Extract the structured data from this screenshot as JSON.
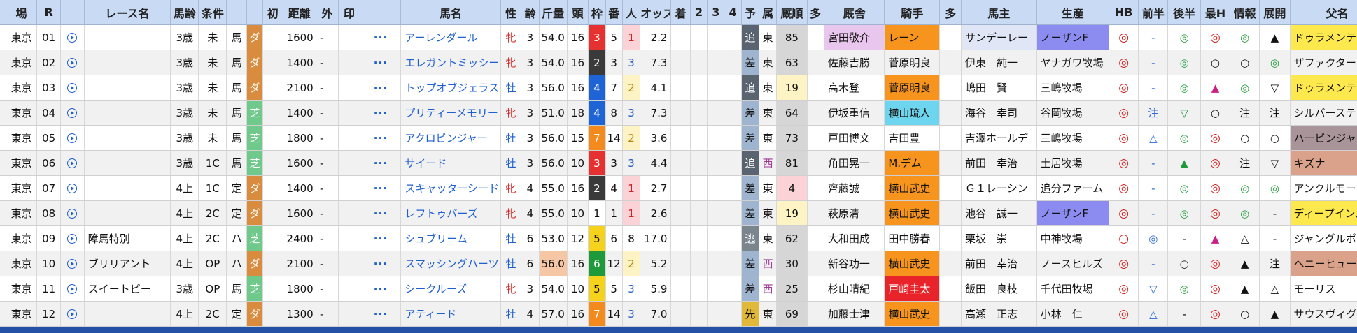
{
  "headers": [
    "場",
    "R",
    "",
    "レース名",
    "馬齢",
    "条件",
    "",
    "初",
    "距離",
    "外",
    "印",
    "",
    "馬名",
    "性",
    "齢",
    "斤量",
    "頭",
    "枠",
    "番",
    "人",
    "オッズ",
    "着",
    "2",
    "3",
    "4",
    "予",
    "属",
    "厩順",
    "多",
    "厩舎",
    "騎手",
    "多",
    "馬主",
    "生産",
    "HB",
    "前半",
    "後半",
    "最H",
    "情報",
    "展開",
    "父名",
    ""
  ],
  "rows": [
    {
      "place": "東京",
      "r": "01",
      "race": "",
      "age": "3歳",
      "cond": "未",
      "kind": "馬",
      "surface": "ダ",
      "dist": "1600",
      "out": "-",
      "horse": "アーレンダール",
      "sex": "牝",
      "old": "3",
      "kinryo": "54.0",
      "heads": "16",
      "waku": "3",
      "ban": "5",
      "pop": "1",
      "odds": "2.2",
      "yoso": "追",
      "zoku": "東",
      "rate": "85",
      "kyusha": "宮田敬介",
      "jockey": "レーン",
      "owner": "サンデーレー",
      "breeder": "ノーザンF",
      "hb": "◎",
      "zen": "-",
      "kou": "◎",
      "saih": "◎",
      "joho": "◎",
      "tenkai": "▲",
      "sire": "ドゥラメンテ"
    },
    {
      "place": "東京",
      "r": "02",
      "race": "",
      "age": "3歳",
      "cond": "未",
      "kind": "馬",
      "surface": "ダ",
      "dist": "1400",
      "out": "-",
      "horse": "エレガントミッシー",
      "sex": "牝",
      "old": "3",
      "kinryo": "54.0",
      "heads": "16",
      "waku": "2",
      "ban": "3",
      "pop": "3",
      "odds": "7.3",
      "yoso": "差",
      "zoku": "東",
      "rate": "63",
      "kyusha": "佐藤吉勝",
      "jockey": "菅原明良",
      "owner": "伊東　純一",
      "breeder": "ヤナガワ牧場",
      "hb": "◎",
      "zen": "-",
      "kou": "◎",
      "saih": "○",
      "joho": "○",
      "tenkai": "◎",
      "sire": "ザファクター"
    },
    {
      "place": "東京",
      "r": "03",
      "race": "",
      "age": "3歳",
      "cond": "未",
      "kind": "馬",
      "surface": "ダ",
      "dist": "2100",
      "out": "-",
      "horse": "トップオブジェラス",
      "sex": "牡",
      "old": "3",
      "kinryo": "56.0",
      "heads": "16",
      "waku": "4",
      "ban": "7",
      "pop": "2",
      "odds": "4.1",
      "yoso": "追",
      "zoku": "東",
      "rate": "19",
      "kyusha": "高木登",
      "jockey": "菅原明良",
      "owner": "嶋田　賢",
      "breeder": "三嶋牧場",
      "hb": "◎",
      "zen": "-",
      "kou": "◎",
      "saih": "▲",
      "joho": "◎",
      "tenkai": "▽",
      "sire": "ドゥラメンテ"
    },
    {
      "place": "東京",
      "r": "04",
      "race": "",
      "age": "3歳",
      "cond": "未",
      "kind": "馬",
      "surface": "芝",
      "dist": "1400",
      "out": "-",
      "horse": "プリティーメモリー",
      "sex": "牝",
      "old": "3",
      "kinryo": "51.0",
      "heads": "18",
      "waku": "4",
      "ban": "8",
      "pop": "3",
      "odds": "7.3",
      "yoso": "差",
      "zoku": "東",
      "rate": "64",
      "kyusha": "伊坂重信",
      "jockey": "横山琉人",
      "owner": "海谷　幸司",
      "breeder": "谷岡牧場",
      "hb": "◎",
      "zen": "注",
      "kou": "▽",
      "saih": "○",
      "joho": "注",
      "tenkai": "注",
      "sire": "シルバーステート"
    },
    {
      "place": "東京",
      "r": "05",
      "race": "",
      "age": "3歳",
      "cond": "未",
      "kind": "馬",
      "surface": "芝",
      "dist": "1800",
      "out": "-",
      "horse": "アクロビンジャー",
      "sex": "牡",
      "old": "3",
      "kinryo": "56.0",
      "heads": "15",
      "waku": "7",
      "ban": "14",
      "pop": "2",
      "odds": "3.6",
      "yoso": "差",
      "zoku": "東",
      "rate": "73",
      "kyusha": "戸田博文",
      "jockey": "吉田豊",
      "owner": "吉澤ホールデ",
      "breeder": "三嶋牧場",
      "hb": "◎",
      "zen": "△",
      "kou": "◎",
      "saih": "◎",
      "joho": "○",
      "tenkai": "○",
      "sire": "ハービンジャー"
    },
    {
      "place": "東京",
      "r": "06",
      "race": "",
      "age": "3歳",
      "cond": "1C",
      "kind": "馬",
      "surface": "芝",
      "dist": "1600",
      "out": "-",
      "horse": "サイード",
      "sex": "牡",
      "old": "3",
      "kinryo": "56.0",
      "heads": "10",
      "waku": "3",
      "ban": "3",
      "pop": "3",
      "odds": "4.4",
      "yoso": "追",
      "zoku": "西",
      "rate": "81",
      "kyusha": "角田晃一",
      "jockey": "M.デム",
      "owner": "前田　幸治",
      "breeder": "土居牧場",
      "hb": "◎",
      "zen": "-",
      "kou": "▲",
      "saih": "◎",
      "joho": "注",
      "tenkai": "▽",
      "sire": "キズナ"
    },
    {
      "place": "東京",
      "r": "07",
      "race": "",
      "age": "4上",
      "cond": "1C",
      "kind": "定",
      "surface": "ダ",
      "dist": "1400",
      "out": "-",
      "horse": "スキャッターシード",
      "sex": "牝",
      "old": "4",
      "kinryo": "55.0",
      "heads": "16",
      "waku": "2",
      "ban": "4",
      "pop": "1",
      "odds": "2.7",
      "yoso": "差",
      "zoku": "東",
      "rate": "4",
      "kyusha": "齊藤誠",
      "jockey": "横山武史",
      "owner": "Ｇ１レーシン",
      "breeder": "追分ファーム",
      "hb": "◎",
      "zen": "-",
      "kou": "◎",
      "saih": "◎",
      "joho": "◎",
      "tenkai": "◎",
      "sire": "アンクルモー"
    },
    {
      "place": "東京",
      "r": "08",
      "race": "",
      "age": "4上",
      "cond": "2C",
      "kind": "定",
      "surface": "ダ",
      "dist": "1600",
      "out": "-",
      "horse": "レフトゥバーズ",
      "sex": "牝",
      "old": "4",
      "kinryo": "55.0",
      "heads": "10",
      "waku": "1",
      "ban": "1",
      "pop": "1",
      "odds": "2.6",
      "yoso": "差",
      "zoku": "東",
      "rate": "19",
      "kyusha": "萩原清",
      "jockey": "横山武史",
      "owner": "池谷　誠一",
      "breeder": "ノーザンF",
      "hb": "◎",
      "zen": "-",
      "kou": "◎",
      "saih": "◎",
      "joho": "◎",
      "tenkai": "-",
      "sire": "ディープインパクト"
    },
    {
      "place": "東京",
      "r": "09",
      "race": "障馬特別",
      "age": "4上",
      "cond": "2C",
      "kind": "ハ",
      "surface": "芝",
      "dist": "2400",
      "out": "-",
      "horse": "シュブリーム",
      "sex": "牡",
      "old": "6",
      "kinryo": "53.0",
      "heads": "12",
      "waku": "5",
      "ban": "6",
      "pop": "8",
      "odds": "17.0",
      "yoso": "逃",
      "zoku": "東",
      "rate": "62",
      "kyusha": "大和田成",
      "jockey": "田中勝春",
      "owner": "栗坂　崇",
      "breeder": "中神牧場",
      "hb": "○",
      "zen": "◎",
      "kou": "-",
      "saih": "▲",
      "joho": "△",
      "tenkai": "-",
      "sire": "ジャングルポケット"
    },
    {
      "place": "東京",
      "r": "10",
      "race": "ブリリアント",
      "age": "4上",
      "cond": "OP",
      "kind": "ハ",
      "surface": "ダ",
      "dist": "2100",
      "out": "-",
      "horse": "スマッシングハーツ",
      "sex": "牡",
      "old": "6",
      "kinryo": "56.0",
      "heads": "16",
      "waku": "6",
      "ban": "12",
      "pop": "2",
      "odds": "5.2",
      "yoso": "差",
      "zoku": "西",
      "rate": "30",
      "kyusha": "新谷功一",
      "jockey": "横山武史",
      "owner": "前田　幸治",
      "breeder": "ノースヒルズ",
      "hb": "◎",
      "zen": "-",
      "kou": "○",
      "saih": "◎",
      "joho": "▲",
      "tenkai": "注",
      "sire": "ヘニーヒューズ"
    },
    {
      "place": "東京",
      "r": "11",
      "race": "スイートピー",
      "age": "3歳",
      "cond": "OP",
      "kind": "馬",
      "surface": "芝",
      "dist": "1800",
      "out": "-",
      "horse": "シークルーズ",
      "sex": "牝",
      "old": "3",
      "kinryo": "54.0",
      "heads": "10",
      "waku": "5",
      "ban": "5",
      "pop": "3",
      "odds": "5.9",
      "yoso": "差",
      "zoku": "西",
      "rate": "25",
      "kyusha": "杉山晴紀",
      "jockey": "戸崎圭太",
      "owner": "飯田　良枝",
      "breeder": "千代田牧場",
      "hb": "◎",
      "zen": "▽",
      "kou": "◎",
      "saih": "◎",
      "joho": "▲",
      "tenkai": "△",
      "sire": "モーリス"
    },
    {
      "place": "東京",
      "r": "12",
      "race": "",
      "age": "4上",
      "cond": "2C",
      "kind": "定",
      "surface": "ダ",
      "dist": "1300",
      "out": "-",
      "horse": "アティード",
      "sex": "牡",
      "old": "4",
      "kinryo": "57.0",
      "heads": "16",
      "waku": "7",
      "ban": "14",
      "pop": "3",
      "odds": "7.0",
      "yoso": "先",
      "zoku": "東",
      "rate": "69",
      "kyusha": "加藤士津",
      "jockey": "横山武史",
      "owner": "高瀬　正志",
      "breeder": "小林　仁",
      "hb": "◎",
      "zen": "△",
      "kou": "-",
      "saih": "◎",
      "joho": "○",
      "tenkai": "▲",
      "sire": "サウスヴィグラス"
    }
  ],
  "colors": {
    "header_bg": "#c9daf4",
    "dirt": "#d98c3d",
    "turf": "#6ec98a",
    "bottom_bar": "#2451a6"
  }
}
